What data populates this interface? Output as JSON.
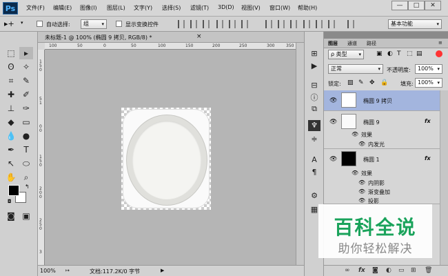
{
  "app": {
    "logo": "Ps",
    "menu": [
      "文件(F)",
      "编辑(E)",
      "图像(I)",
      "图层(L)",
      "文字(Y)",
      "选择(S)",
      "滤镜(T)",
      "3D(D)",
      "视图(V)",
      "窗口(W)",
      "帮助(H)"
    ],
    "min": "—",
    "max": "□",
    "close": "✕"
  },
  "options": {
    "auto_select_label": "自动选择:",
    "auto_select_value": "组",
    "show_transform": "显示变换控件",
    "workspace": "基本功能"
  },
  "document": {
    "tab": "未标题-1 @ 100% (椭圆 9 拷贝, RGB/8) *",
    "close": "×",
    "ruler_h": [
      "100",
      "50",
      "0",
      "50",
      "100",
      "150",
      "200",
      "250",
      "300",
      "350"
    ],
    "ruler_v": [
      "1",
      "5",
      "0",
      "5",
      "1",
      "0",
      "0",
      "1",
      "5",
      "0",
      "2",
      "0",
      "0",
      "2",
      "5",
      "0",
      "3"
    ]
  },
  "status": {
    "zoom": "100%",
    "doc": "文档:117.2K/0 字节"
  },
  "layers": {
    "tabs": [
      "图层",
      "通道",
      "路径"
    ],
    "filter": "ρ 类型",
    "blend": "正常",
    "opacity_label": "不透明度:",
    "opacity": "100%",
    "lock_label": "锁定:",
    "fill_label": "填充:",
    "fill": "100%",
    "items": [
      {
        "name": "椭圆 9 拷贝",
        "selected": true,
        "fx": ""
      },
      {
        "name": "椭圆 9",
        "selected": false,
        "fx": "fx"
      },
      {
        "name": "椭圆 1",
        "selected": false,
        "fx": "fx"
      }
    ],
    "effects_label": "效果",
    "e9": [
      "内发光"
    ],
    "e1": [
      "内阴影",
      "渐变叠加",
      "投影"
    ]
  },
  "watermark": {
    "title": "百科全说",
    "sub": "助你轻松解决"
  }
}
